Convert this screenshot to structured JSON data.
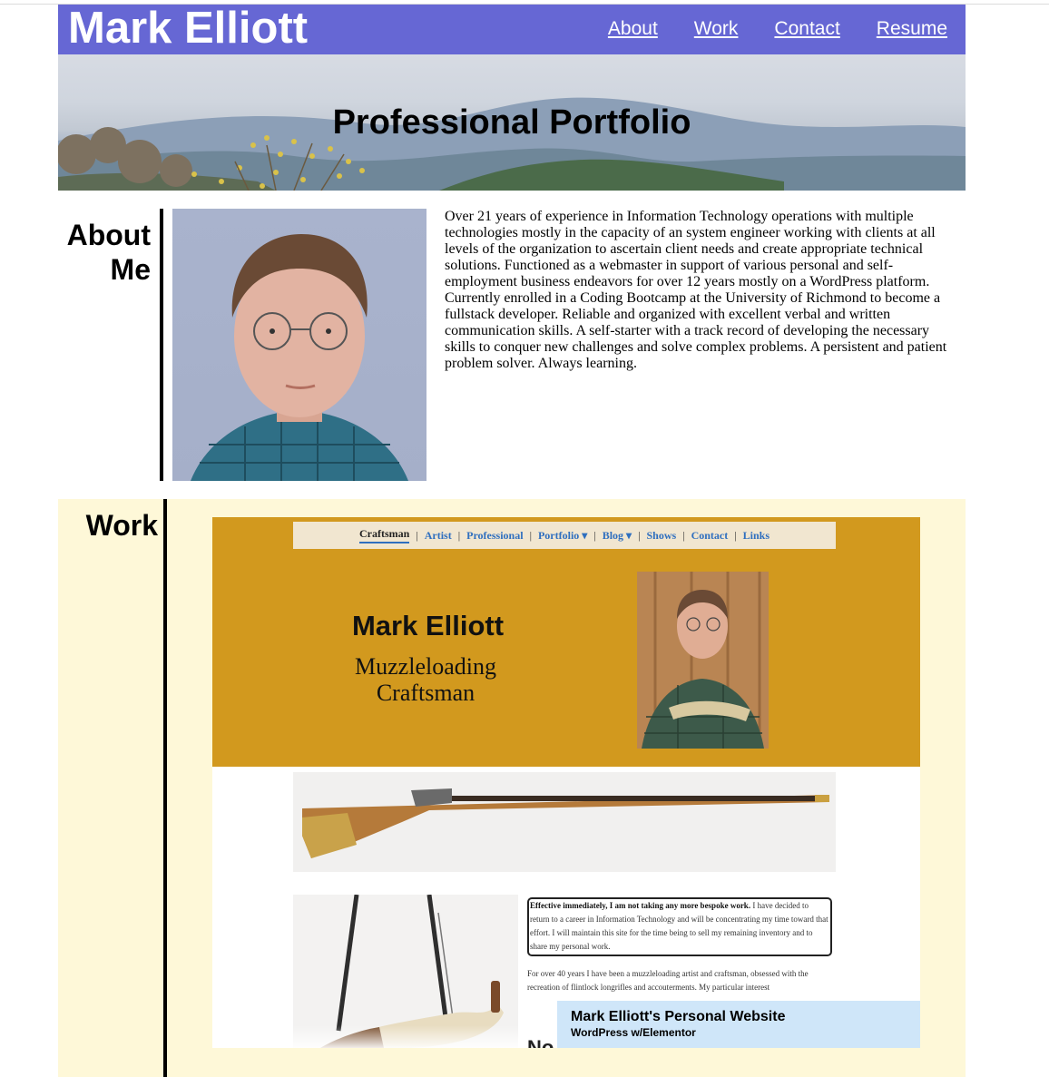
{
  "header": {
    "site_title": "Mark Elliott",
    "nav": [
      "About",
      "Work",
      "Contact",
      "Resume"
    ]
  },
  "hero": {
    "title": "Professional Portfolio"
  },
  "about": {
    "heading_line1": "About",
    "heading_line2": "Me",
    "text": "Over 21 years of experience in Information Technology operations with multiple technologies mostly in the capacity of an system engineer working with clients at all levels of the organization to ascertain client needs and create appropriate technical solutions. Functioned as a webmaster in support of various personal and self-employment business endeavors for over 12 years mostly on a WordPress platform. Currently enrolled in a Coding Bootcamp at the University of Richmond to become a fullstack developer. Reliable and organized with excellent verbal and written communication skills. A self-starter with a track record of developing the necessary skills to conquer new challenges and solve complex problems. A persistent and patient problem solver. Always learning."
  },
  "work": {
    "heading": "Work",
    "screenshot": {
      "nav": [
        "Craftsman",
        "Artist",
        "Professional",
        "Portfolio ▾",
        "Blog ▾",
        "Shows",
        "Contact",
        "Links"
      ],
      "name": "Mark Elliott",
      "subtitle_line1": "Muzzleloading",
      "subtitle_line2": "Craftsman",
      "notice_bold": "Effective immediately, I am not taking any more bespoke work.",
      "notice_rest": " I have decided to return to a career in Information Technology and will be concentrating my time toward that effort.   I will maintain this site for the time being to sell my remaining inventory and to share my personal work.",
      "paragraph": "For over 40 years I have been a muzzleloading artist and craftsman, obsessed with the recreation of flintlock longrifles and accouterments. My particular interest",
      "partial_heading": "No"
    },
    "caption_title": "Mark Elliott's Personal Website",
    "caption_sub": "WordPress w/Elementor"
  },
  "colors": {
    "header_bg": "#6667d4",
    "work_bg": "#fef8d8",
    "caption_bg": "#cfe6f9",
    "screenshot_gold": "#d2991e",
    "link_blue": "#2f6fbf"
  }
}
